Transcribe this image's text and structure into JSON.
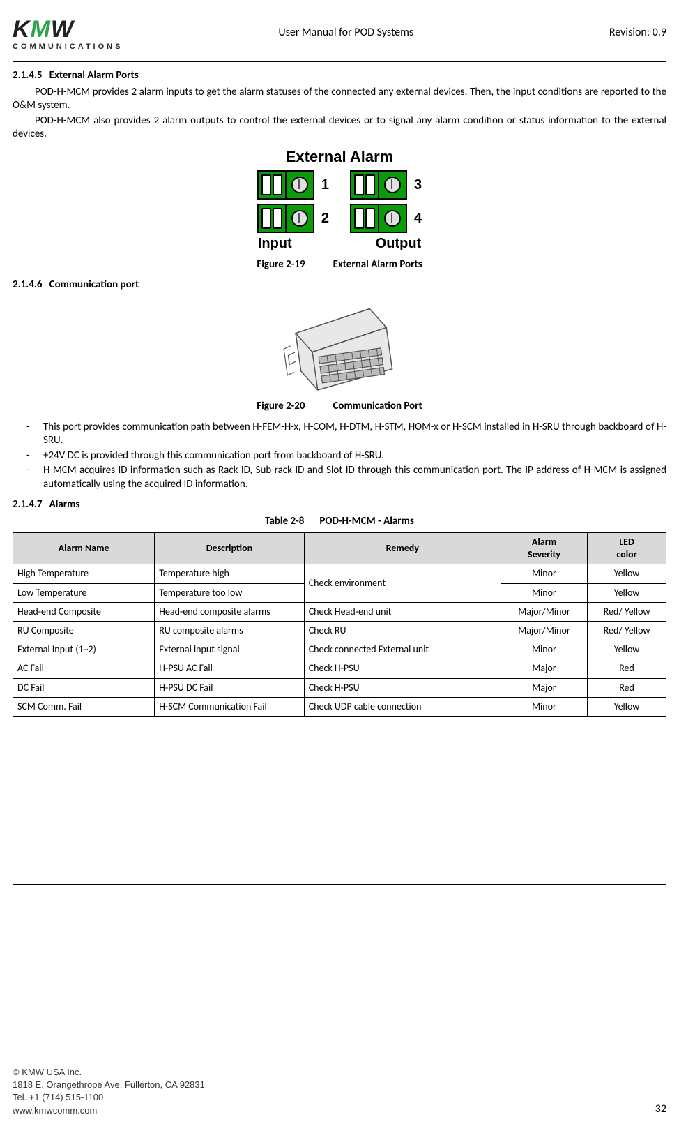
{
  "header": {
    "logo_main": "KMW",
    "logo_sub": "COMMUNICATIONS",
    "title": "User Manual for POD Systems",
    "revision": "Revision: 0.9"
  },
  "sec_2145": {
    "num": "2.1.4.5",
    "title": "External Alarm Ports",
    "p1": "POD-H-MCM provides 2 alarm inputs to get the alarm statuses of the connected any external devices. Then, the input conditions are reported to the O&M system.",
    "p2": "POD-H-MCM also provides 2 alarm outputs to control the external devices or to signal any alarm condition or status information to the external devices."
  },
  "fig219": {
    "heading": "External Alarm",
    "input_label": "Input",
    "output_label": "Output",
    "nums": [
      "1",
      "2",
      "3",
      "4"
    ],
    "caption_num": "Figure 2-19",
    "caption_text": "External Alarm Ports"
  },
  "sec_2146": {
    "num": "2.1.4.6",
    "title": "Communication port"
  },
  "fig220": {
    "caption_num": "Figure 2-20",
    "caption_text": "Communication Port"
  },
  "bullets": [
    "This port provides communication path between H-FEM-H-x, H-COM, H-DTM, H-STM, HOM-x or H-SCM installed in H-SRU through backboard of H-SRU.",
    "+24V DC is provided through this communication port from backboard of H-SRU.",
    "H-MCM acquires ID information such as Rack ID, Sub rack ID and Slot ID through this communication port. The IP address of H-MCM is assigned automatically using the acquired ID information."
  ],
  "sec_2147": {
    "num": "2.1.4.7",
    "title": "Alarms"
  },
  "table28": {
    "caption_num": "Table 2-8",
    "caption_text": "POD-H-MCM - Alarms",
    "headers": {
      "name": "Alarm Name",
      "desc": "Description",
      "remedy": "Remedy",
      "sev": "Alarm Severity",
      "led": "LED color"
    },
    "rows": [
      {
        "name": "High Temperature",
        "desc": "Temperature high",
        "remedy": "Check environment",
        "sev": "Minor",
        "led": "Yellow",
        "rowspan_remedy": 2
      },
      {
        "name": "Low Temperature",
        "desc": "Temperature too low",
        "remedy": "",
        "sev": "Minor",
        "led": "Yellow"
      },
      {
        "name": "Head-end Composite",
        "desc": "Head-end composite alarms",
        "remedy": "Check Head-end unit",
        "sev": "Major/Minor",
        "led": "Red/ Yellow"
      },
      {
        "name": "RU Composite",
        "desc": "RU composite alarms",
        "remedy": "Check RU",
        "sev": "Major/Minor",
        "led": "Red/ Yellow"
      },
      {
        "name": "External Input (1~2)",
        "desc": "External input signal",
        "remedy": "Check connected External unit",
        "sev": "Minor",
        "led": "Yellow"
      },
      {
        "name": "AC Fail",
        "desc": "H-PSU AC Fail",
        "remedy": "Check H-PSU",
        "sev": "Major",
        "led": "Red"
      },
      {
        "name": "DC Fail",
        "desc": "H-PSU DC Fail",
        "remedy": "Check H-PSU",
        "sev": "Major",
        "led": "Red"
      },
      {
        "name": "SCM Comm. Fail",
        "desc": "H-SCM Communication  Fail",
        "remedy": "Check UDP cable connection",
        "sev": "Minor",
        "led": "Yellow"
      }
    ]
  },
  "footer": {
    "copyright": "© KMW USA Inc.",
    "addr": "1818 E. Orangethrope Ave, Fullerton, CA 92831",
    "tel": "Tel. +1 (714) 515-1100",
    "web": "www.kmwcomm.com",
    "page": "32"
  }
}
